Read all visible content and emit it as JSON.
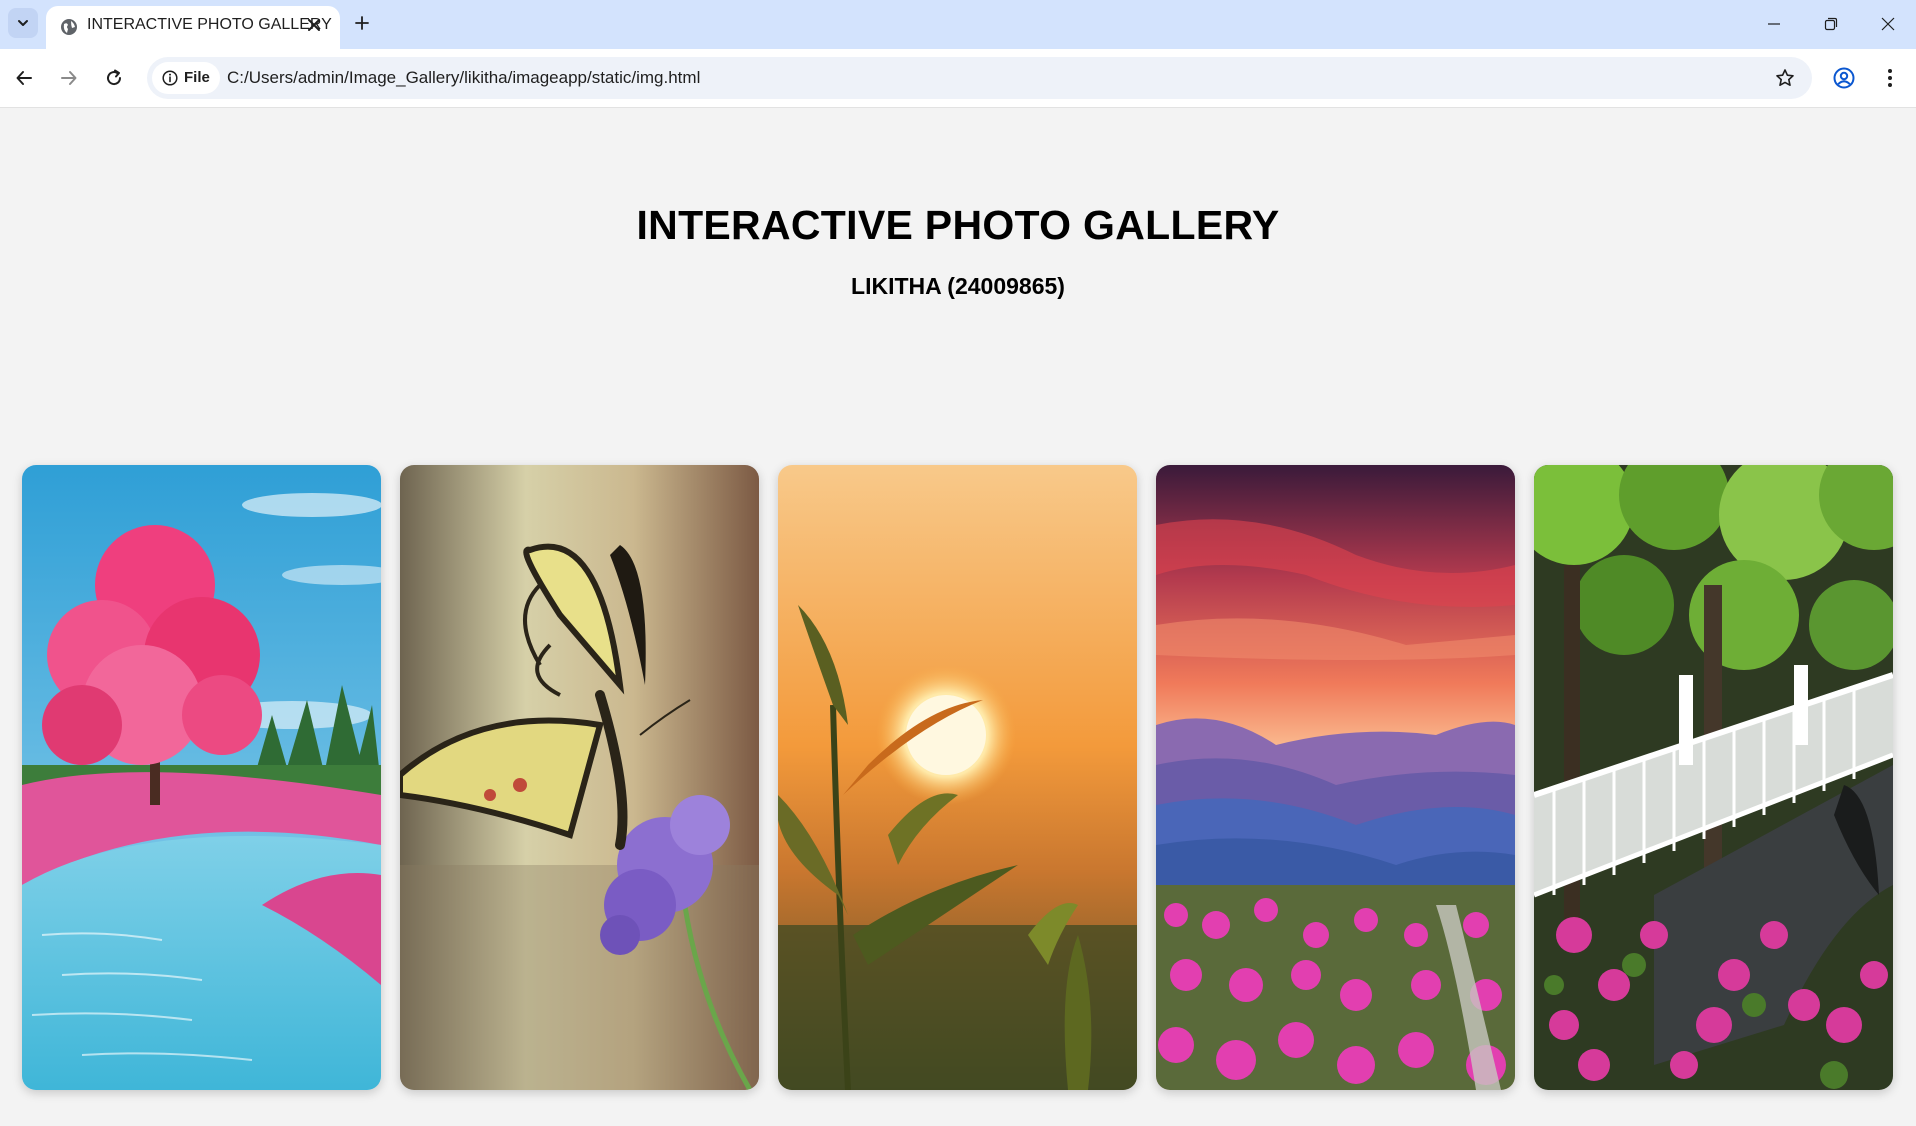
{
  "browser": {
    "tab_title": "INTERACTIVE PHOTO GALLERY",
    "site_chip_label": "File",
    "url": "C:/Users/admin/Image_Gallery/likitha/imageapp/static/img.html"
  },
  "page": {
    "title": "INTERACTIVE PHOTO GALLERY",
    "subtitle": "LIKITHA (24009865)"
  },
  "gallery": {
    "photos": [
      {
        "subject": "pink-tree-river"
      },
      {
        "subject": "swallowtail-butterfly-on-lavender-flower"
      },
      {
        "subject": "sunset-seedling"
      },
      {
        "subject": "mountain-sunset-flower-meadow"
      },
      {
        "subject": "white-bridge-garden"
      }
    ]
  },
  "icons": [
    "tab-search-icon",
    "globe-icon",
    "close-icon",
    "plus-icon",
    "minimize-icon",
    "restore-icon",
    "window-close-icon",
    "back-arrow-icon",
    "forward-arrow-icon",
    "reload-icon",
    "info-icon",
    "star-icon",
    "profile-icon",
    "menu-dots-icon"
  ],
  "colors": {
    "tabbar": "#d3e3fd",
    "page_background": "#f3f3f3",
    "profile_accent": "#0b57d0"
  }
}
